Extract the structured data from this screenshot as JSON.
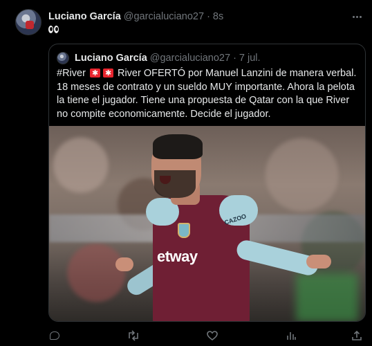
{
  "tweet": {
    "author_name": "Luciano García",
    "author_handle": "@garcialuciano27",
    "separator": "·",
    "time": "8s",
    "emoji_name": "eyes-emoji"
  },
  "quoted": {
    "author_name": "Luciano García",
    "author_handle": "@garcialuciano27",
    "separator": "·",
    "time": "7 jul.",
    "text_parts": {
      "hashtag": "#River",
      "after_flags": "River OFERTÓ por Manuel Lanzini de manera verbal. 18 meses de contrato y un sueldo MUY importante. Ahora la pelota la tiene el jugador. Tiene una propuesta de Qatar con la que River no compite economicamente. Decide el jugador."
    },
    "flag_icon": "river-plate-flag",
    "media": {
      "sponsor_text": "etway",
      "kit_text": "CAZOO"
    }
  },
  "actions": [
    "reply-icon",
    "retweet-icon",
    "like-icon",
    "views-icon",
    "share-icon"
  ],
  "colors": {
    "background": "#000000",
    "text": "#e7e9ea",
    "muted": "#71767b",
    "border": "#2f3336"
  }
}
